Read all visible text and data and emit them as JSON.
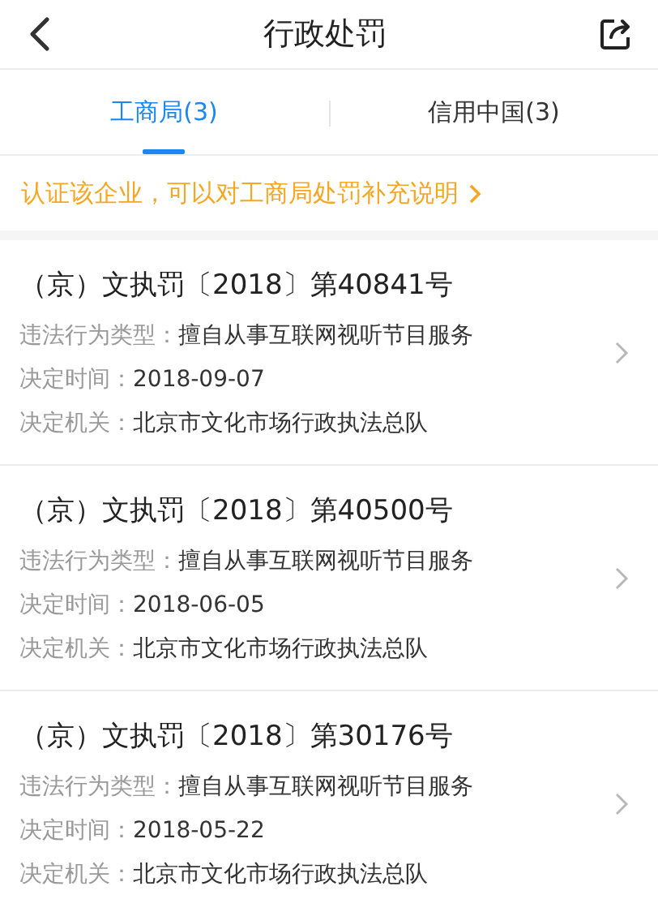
{
  "header": {
    "title": "行政处罚"
  },
  "tabs": [
    {
      "label": "工商局(3)",
      "selected": true
    },
    {
      "label": "信用中国(3)",
      "selected": false
    }
  ],
  "notice": {
    "text": "认证该企业，可以对工商局处罚补充说明"
  },
  "records": [
    {
      "title": "（京）文执罚〔2018〕第40841号",
      "fields": [
        {
          "label": "违法行为类型：",
          "value": "擅自从事互联网视听节目服务"
        },
        {
          "label": "决定时间：",
          "value": "2018-09-07"
        },
        {
          "label": "决定机关：",
          "value": "北京市文化市场行政执法总队"
        }
      ]
    },
    {
      "title": "（京）文执罚〔2018〕第40500号",
      "fields": [
        {
          "label": "违法行为类型：",
          "value": "擅自从事互联网视听节目服务"
        },
        {
          "label": "决定时间：",
          "value": "2018-06-05"
        },
        {
          "label": "决定机关：",
          "value": "北京市文化市场行政执法总队"
        }
      ]
    },
    {
      "title": "（京）文执罚〔2018〕第30176号",
      "fields": [
        {
          "label": "违法行为类型：",
          "value": "擅自从事互联网视听节目服务"
        },
        {
          "label": "决定时间：",
          "value": "2018-05-22"
        },
        {
          "label": "决定机关：",
          "value": "北京市文化市场行政执法总队"
        }
      ]
    }
  ]
}
